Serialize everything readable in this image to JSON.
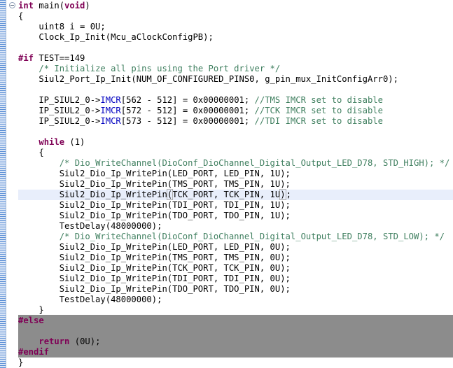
{
  "editor": {
    "lines": [
      [
        {
          "t": "int",
          "c": "kw"
        },
        {
          "t": " main(",
          "c": ""
        },
        {
          "t": "void",
          "c": "kw"
        },
        {
          "t": ")",
          "c": ""
        }
      ],
      [
        {
          "t": "{",
          "c": ""
        }
      ],
      [
        {
          "t": "    uint8 i = 0U;",
          "c": ""
        }
      ],
      [
        {
          "t": "    Clock_Ip_Init(Mcu_aClockConfigPB);",
          "c": ""
        }
      ],
      [],
      [
        {
          "t": "#if",
          "c": "pp"
        },
        {
          "t": " TEST==149",
          "c": ""
        }
      ],
      [
        {
          "t": "    ",
          "c": ""
        },
        {
          "t": "/* Initialize all pins using the Port driver */",
          "c": "cmt"
        }
      ],
      [
        {
          "t": "    Siul2_Port_Ip_Init(NUM_OF_CONFIGURED_PINS0, g_pin_mux_InitConfigArr0);",
          "c": ""
        }
      ],
      [],
      [
        {
          "t": "    IP_SIUL2_0->",
          "c": ""
        },
        {
          "t": "IMCR",
          "c": "fld"
        },
        {
          "t": "[562 - 512] = 0x00000001; ",
          "c": ""
        },
        {
          "t": "//TMS IMCR set to disable",
          "c": "cmt"
        }
      ],
      [
        {
          "t": "    IP_SIUL2_0->",
          "c": ""
        },
        {
          "t": "IMCR",
          "c": "fld"
        },
        {
          "t": "[572 - 512] = 0x00000001; ",
          "c": ""
        },
        {
          "t": "//TCK IMCR set to disable",
          "c": "cmt"
        }
      ],
      [
        {
          "t": "    IP_SIUL2_0->",
          "c": ""
        },
        {
          "t": "IMCR",
          "c": "fld"
        },
        {
          "t": "[573 - 512] = 0x00000001; ",
          "c": ""
        },
        {
          "t": "//TDI IMCR set to disable",
          "c": "cmt"
        }
      ],
      [],
      [
        {
          "t": "    ",
          "c": ""
        },
        {
          "t": "while",
          "c": "kw"
        },
        {
          "t": " (1)",
          "c": ""
        }
      ],
      [
        {
          "t": "    {",
          "c": ""
        }
      ],
      [
        {
          "t": "        ",
          "c": ""
        },
        {
          "t": "/* Dio_WriteChannel(DioConf_DioChannel_Digital_Output_LED_D78, STD_HIGH); */",
          "c": "cmt"
        }
      ],
      [
        {
          "t": "        Siul2_Dio_Ip_WritePin(LED_PORT, LED_PIN, 1U);",
          "c": ""
        }
      ],
      [
        {
          "t": "        Siul2_Dio_Ip_WritePin(TMS_PORT, TMS_PIN, 1U);",
          "c": ""
        }
      ],
      [
        {
          "t": "        Siul2_Dio_Ip_WritePin",
          "c": ""
        },
        {
          "t": "(",
          "c": "bracket"
        },
        {
          "t": "TCK_PORT, TCK_PIN, 1U",
          "c": ""
        },
        {
          "t": ")",
          "c": "bracket"
        },
        {
          "t": "|",
          "c": "caret"
        },
        {
          "t": ";",
          "c": ""
        }
      ],
      [
        {
          "t": "        Siul2_Dio_Ip_WritePin(TDI_PORT, TDI_PIN, 1U);",
          "c": ""
        }
      ],
      [
        {
          "t": "        Siul2_Dio_Ip_WritePin(TDO_PORT, TDO_PIN, 1U);",
          "c": ""
        }
      ],
      [
        {
          "t": "        TestDelay(48000000);",
          "c": ""
        }
      ],
      [
        {
          "t": "        ",
          "c": ""
        },
        {
          "t": "/* Dio_WriteChannel(DioConf_DioChannel_Digital_Output_LED_D78, STD_LOW); */",
          "c": "cmt"
        }
      ],
      [
        {
          "t": "        Siul2_Dio_Ip_WritePin(LED_PORT, LED_PIN, 0U);",
          "c": ""
        }
      ],
      [
        {
          "t": "        Siul2_Dio_Ip_WritePin(TMS_PORT, TMS_PIN, 0U);",
          "c": ""
        }
      ],
      [
        {
          "t": "        Siul2_Dio_Ip_WritePin(TCK_PORT, TCK_PIN, 0U);",
          "c": ""
        }
      ],
      [
        {
          "t": "        Siul2_Dio_Ip_WritePin(TDI_PORT, TDI_PIN, 0U);",
          "c": ""
        }
      ],
      [
        {
          "t": "        Siul2_Dio_Ip_WritePin(TDO_PORT, TDO_PIN, 0U);",
          "c": ""
        }
      ],
      [
        {
          "t": "        TestDelay(48000000);",
          "c": ""
        }
      ],
      [
        {
          "t": "    }",
          "c": ""
        }
      ],
      [
        {
          "t": "#else",
          "c": "pp"
        }
      ],
      [],
      [
        {
          "t": "    ",
          "c": ""
        },
        {
          "t": "return",
          "c": "kw"
        },
        {
          "t": " (0U);",
          "c": ""
        }
      ],
      [
        {
          "t": "#endif",
          "c": "pp"
        }
      ],
      [
        {
          "t": "}",
          "c": ""
        }
      ]
    ],
    "current_line_index": 18,
    "inactive_block_start_index": 30,
    "inactive_block_end_index": 33
  },
  "colors": {
    "keyword": "#7f0055",
    "comment": "#3f7f5f",
    "field": "#0000c0",
    "current_line": "#e8eefb",
    "inactive_code": "#8c8c8c"
  }
}
